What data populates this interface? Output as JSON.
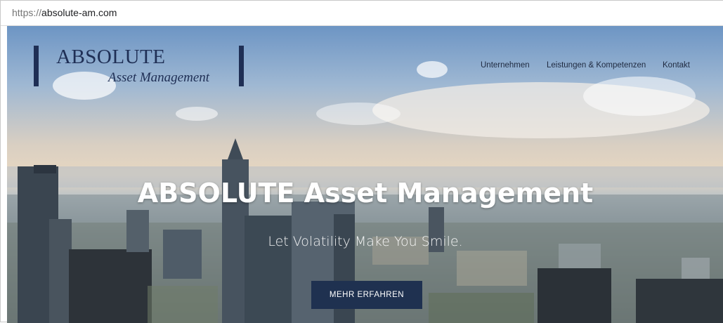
{
  "browser": {
    "url_scheme": "https://",
    "url_host": "absolute-am.com"
  },
  "logo": {
    "name": "ABSOLUTE",
    "subtitle": "Asset Management"
  },
  "nav": {
    "items": [
      "Unternehmen",
      "Leistungen & Kompetenzen",
      "Kontakt"
    ]
  },
  "hero": {
    "title": "ABSOLUTE Asset Management",
    "tagline": "Let Volatility Make You Smile.",
    "cta_label": "MEHR ERFAHREN"
  },
  "colors": {
    "brand_navy": "#1f2f55",
    "button_bg": "#1f3150"
  }
}
